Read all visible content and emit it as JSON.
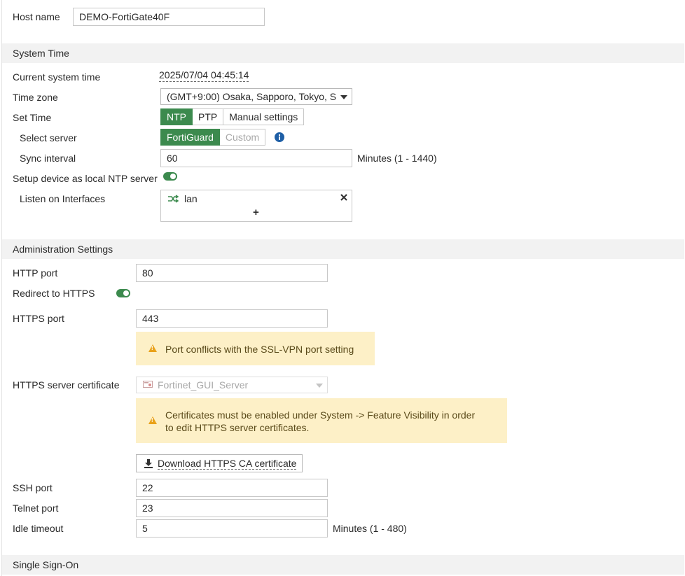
{
  "host": {
    "label": "Host name",
    "value": "DEMO-FortiGate40F"
  },
  "system_time": {
    "section_title": "System Time",
    "current_label": "Current system time",
    "current_value": "2025/07/04 04:45:14",
    "timezone_label": "Time zone",
    "timezone_value": "(GMT+9:00) Osaka, Sapporo, Tokyo, S",
    "set_time_label": "Set Time",
    "set_time_options": [
      "NTP",
      "PTP",
      "Manual settings"
    ],
    "set_time_selected": "NTP",
    "select_server_label": "Select server",
    "server_options": [
      "FortiGuard",
      "Custom"
    ],
    "server_selected": "FortiGuard",
    "sync_label": "Sync interval",
    "sync_value": "60",
    "sync_unit": "Minutes (1 - 1440)",
    "local_ntp_label": "Setup device as local NTP server",
    "local_ntp_enabled": true,
    "listen_label": "Listen on Interfaces",
    "interfaces": [
      "lan"
    ],
    "add_symbol": "+"
  },
  "admin": {
    "section_title": "Administration Settings",
    "http_label": "HTTP port",
    "http_value": "80",
    "redirect_label": "Redirect to HTTPS",
    "redirect_enabled": true,
    "https_label": "HTTPS port",
    "https_value": "443",
    "https_warning": "Port conflicts with the SSL-VPN port setting",
    "cert_label": "HTTPS server certificate",
    "cert_value": "Fortinet_GUI_Server",
    "cert_warning_line1": "Certificates must be enabled under System -> Feature Visibility in order",
    "cert_warning_line2": "to edit HTTPS server certificates.",
    "download_label": "Download HTTPS CA certificate",
    "ssh_label": "SSH port",
    "ssh_value": "22",
    "telnet_label": "Telnet port",
    "telnet_value": "23",
    "idle_label": "Idle timeout",
    "idle_value": "5",
    "idle_unit": "Minutes (1 - 480)"
  },
  "sso": {
    "section_title": "Single Sign-On"
  },
  "colors": {
    "accent_green": "#3c8a4e",
    "warning_bg": "#fdf0c7",
    "info_blue": "#1f5fa6",
    "warning_icon": "#e9a21a"
  }
}
